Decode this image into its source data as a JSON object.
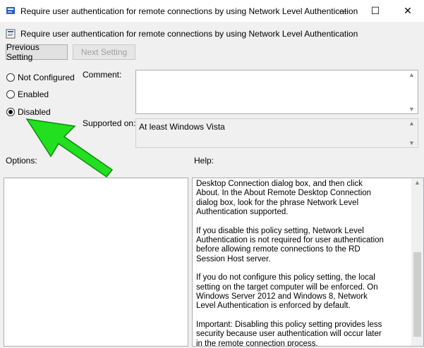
{
  "window": {
    "title": "Require user authentication for remote connections by using Network Level Authentication",
    "minimize_glyph": "—",
    "maximize_glyph": "☐",
    "close_glyph": "✕"
  },
  "header": {
    "title": "Require user authentication for remote connections by using Network Level Authentication"
  },
  "nav": {
    "previous_label": "Previous Setting",
    "next_label": "Next Setting"
  },
  "state": {
    "options": [
      {
        "label": "Not Configured",
        "checked": false
      },
      {
        "label": "Enabled",
        "checked": false
      },
      {
        "label": "Disabled",
        "checked": true
      }
    ]
  },
  "comment": {
    "label": "Comment:",
    "value": ""
  },
  "supported": {
    "label": "Supported on:",
    "value": "At least Windows Vista"
  },
  "options_label": "Options:",
  "help_label": "Help:",
  "help": {
    "paragraphs": [
      "Desktop Connection dialog box, and then click About. In the About Remote Desktop Connection dialog box, look for the phrase Network Level Authentication supported.",
      "If you disable this policy setting, Network Level Authentication is not required for user authentication before allowing remote connections to the RD Session Host server.",
      "If you do not configure this policy setting, the local setting on the target computer will be enforced. On Windows Server 2012 and Windows 8, Network Level Authentication is enforced by default.",
      "Important: Disabling this policy setting provides less security because user authentication will occur later in the remote connection process."
    ]
  },
  "colors": {
    "arrow": "#22e01f",
    "arrow_outline": "#0f8a0c"
  }
}
